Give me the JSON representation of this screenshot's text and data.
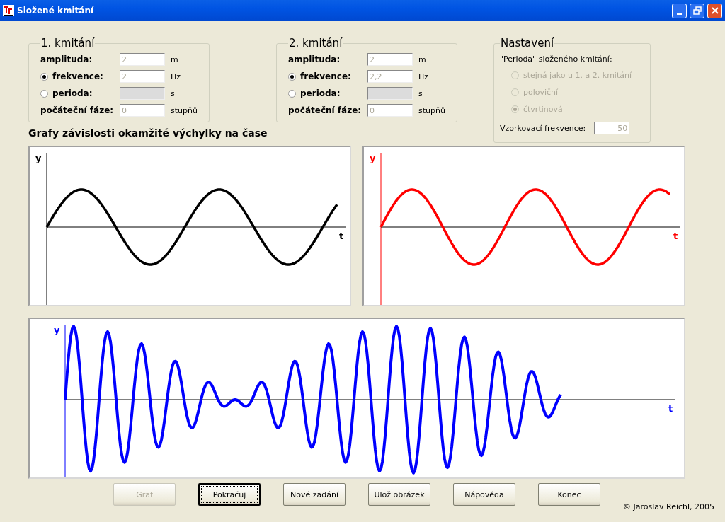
{
  "window": {
    "title": "Složené kmitání"
  },
  "oscillations": [
    {
      "title": "1. kmitání",
      "rows": [
        {
          "kind": "plain",
          "label": "amplituda:",
          "value": "2",
          "unit": "m"
        },
        {
          "kind": "radio",
          "selected": true,
          "label": "frekvence:",
          "value": "2",
          "unit": "Hz"
        },
        {
          "kind": "radio",
          "selected": false,
          "label": "perioda:",
          "unit": "s"
        },
        {
          "kind": "plain",
          "label": "počáteční fáze:",
          "value": "0",
          "unit": "stupňů"
        }
      ]
    },
    {
      "title": "2. kmitání",
      "rows": [
        {
          "kind": "plain",
          "label": "amplituda:",
          "value": "2",
          "unit": "m"
        },
        {
          "kind": "radio",
          "selected": true,
          "label": "frekvence:",
          "value": "2,2",
          "unit": "Hz"
        },
        {
          "kind": "radio",
          "selected": false,
          "label": "perioda:",
          "unit": "s"
        },
        {
          "kind": "plain",
          "label": "počáteční fáze:",
          "value": "0",
          "unit": "stupňů"
        }
      ]
    }
  ],
  "settings": {
    "title": "Nastavení",
    "prompt": "\"Perioda\" složeného kmitání:",
    "options_disabled": true,
    "options": [
      {
        "label": "stejná jako u 1. a 2. kmitání",
        "selected": false
      },
      {
        "label": "poloviční",
        "selected": false
      },
      {
        "label": "čtvrtinová",
        "selected": true
      }
    ],
    "sampling_label": "Vzorkovací frekvence:",
    "sampling_value": "50"
  },
  "graphs_heading": "Grafy závislosti okamžité výchylky na čase",
  "graphs": [
    {
      "kind": "single",
      "y_label": "y",
      "t_label": "t",
      "color": "#000000"
    },
    {
      "kind": "single2",
      "y_label": "y",
      "t_label": "t",
      "color": "#ff0000"
    },
    {
      "kind": "sum",
      "y_label": "y",
      "t_label": "t",
      "color": "#0000ff"
    }
  ],
  "buttons": [
    {
      "label": "Graf",
      "disabled": true,
      "focused": false
    },
    {
      "label": "Pokračuj",
      "disabled": false,
      "focused": true
    },
    {
      "label": "Nové zadání",
      "disabled": false,
      "focused": false
    },
    {
      "label": "Ulož obrázek",
      "disabled": false,
      "focused": false
    },
    {
      "label": "Nápověda",
      "disabled": false,
      "focused": false
    },
    {
      "label": "Konec",
      "disabled": false,
      "focused": false
    }
  ],
  "copyright": "© Jaroslav Reichl, 2005"
}
